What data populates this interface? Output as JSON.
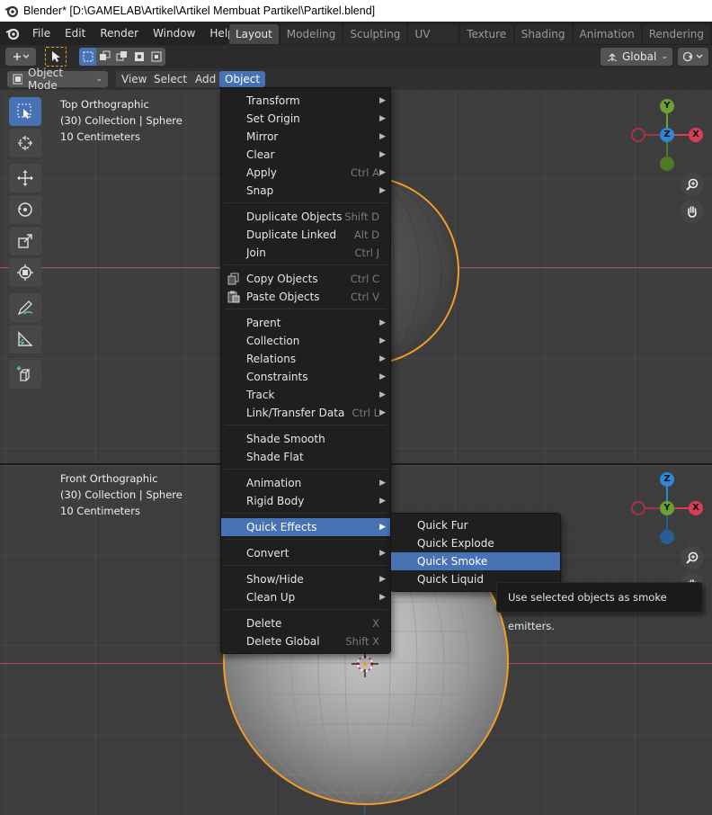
{
  "window": {
    "title": "Blender* [D:\\GAMELAB\\Artikel\\Artikel Membuat Partikel\\Partikel.blend]"
  },
  "topmenu": {
    "items": [
      "File",
      "Edit",
      "Render",
      "Window",
      "Help"
    ]
  },
  "workspaces": {
    "tabs": [
      "Layout",
      "Modeling",
      "Sculpting",
      "UV Editing",
      "Texture Paint",
      "Shading",
      "Animation",
      "Rendering"
    ],
    "active": "Layout"
  },
  "toolheader": {
    "orientation": "Global"
  },
  "viewport_header": {
    "mode": "Object Mode",
    "menus": [
      "View",
      "Select",
      "Add",
      "Object"
    ],
    "active_menu": "Object"
  },
  "viewport_top": {
    "view": "Top Orthographic",
    "collection": "(30) Collection | Sphere",
    "scale": "10 Centimeters",
    "gizmo": {
      "up": "Y",
      "center": "Z",
      "right": "X"
    }
  },
  "viewport_front": {
    "view": "Front Orthographic",
    "collection": "(30) Collection | Sphere",
    "scale": "10 Centimeters",
    "gizmo": {
      "up": "Z",
      "center": "Y",
      "right": "X"
    }
  },
  "object_menu": {
    "items": [
      {
        "label": "Transform",
        "shortcut": "",
        "submenu": true
      },
      {
        "label": "Set Origin",
        "shortcut": "",
        "submenu": true
      },
      {
        "label": "Mirror",
        "shortcut": "",
        "submenu": true
      },
      {
        "label": "Clear",
        "shortcut": "",
        "submenu": true
      },
      {
        "label": "Apply",
        "shortcut": "Ctrl A",
        "submenu": true
      },
      {
        "label": "Snap",
        "shortcut": "",
        "submenu": true
      },
      {
        "label": "Duplicate Objects",
        "shortcut": "Shift D",
        "submenu": false
      },
      {
        "label": "Duplicate Linked",
        "shortcut": "Alt D",
        "submenu": false
      },
      {
        "label": "Join",
        "shortcut": "Ctrl J",
        "submenu": false
      },
      {
        "label": "Copy Objects",
        "shortcut": "Ctrl C",
        "submenu": false
      },
      {
        "label": "Paste Objects",
        "shortcut": "Ctrl V",
        "submenu": false
      },
      {
        "label": "Parent",
        "shortcut": "",
        "submenu": true
      },
      {
        "label": "Collection",
        "shortcut": "",
        "submenu": true
      },
      {
        "label": "Relations",
        "shortcut": "",
        "submenu": true
      },
      {
        "label": "Constraints",
        "shortcut": "",
        "submenu": true
      },
      {
        "label": "Track",
        "shortcut": "",
        "submenu": true
      },
      {
        "label": "Link/Transfer Data",
        "shortcut": "Ctrl L",
        "submenu": true
      },
      {
        "label": "Shade Smooth",
        "shortcut": "",
        "submenu": false
      },
      {
        "label": "Shade Flat",
        "shortcut": "",
        "submenu": false
      },
      {
        "label": "Animation",
        "shortcut": "",
        "submenu": true
      },
      {
        "label": "Rigid Body",
        "shortcut": "",
        "submenu": true
      },
      {
        "label": "Quick Effects",
        "shortcut": "",
        "submenu": true
      },
      {
        "label": "Convert",
        "shortcut": "",
        "submenu": true
      },
      {
        "label": "Show/Hide",
        "shortcut": "",
        "submenu": true
      },
      {
        "label": "Clean Up",
        "shortcut": "",
        "submenu": true
      },
      {
        "label": "Delete",
        "shortcut": "X",
        "submenu": false
      },
      {
        "label": "Delete Global",
        "shortcut": "Shift X",
        "submenu": false
      }
    ],
    "highlighted": "Quick Effects"
  },
  "quick_effects_menu": {
    "items": [
      "Quick Fur",
      "Quick Explode",
      "Quick Smoke",
      "Quick Liquid"
    ],
    "highlighted": "Quick Smoke"
  },
  "tooltip": {
    "text": "Use selected objects as smoke emitters."
  },
  "colors": {
    "accent": "#4772b3",
    "selection_outline": "#f29c2a",
    "axis_x": "#d93f54",
    "axis_y": "#6ba132",
    "axis_z": "#2e86d9"
  }
}
